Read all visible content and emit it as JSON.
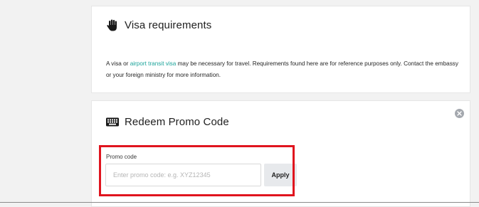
{
  "visa": {
    "title": "Visa requirements",
    "text_before_link": "A visa or ",
    "link_text": "airport transit visa",
    "text_after_link": " may be necessary for travel. Requirements found here are for reference purposes only. Contact the embassy or your foreign ministry for more information.",
    "icon": "hand-stop-icon"
  },
  "promo": {
    "title": "Redeem Promo Code",
    "icon": "keyboard-icon",
    "label": "Promo code",
    "placeholder": "Enter promo code: e.g. XYZ12345",
    "value": "",
    "apply_label": "Apply",
    "close_icon": "close-circle-icon"
  },
  "colors": {
    "link": "#1aa39a",
    "highlight": "#e0141e",
    "background": "#f2f2f2",
    "card": "#ffffff",
    "apply_bg": "#e7e9ec"
  }
}
